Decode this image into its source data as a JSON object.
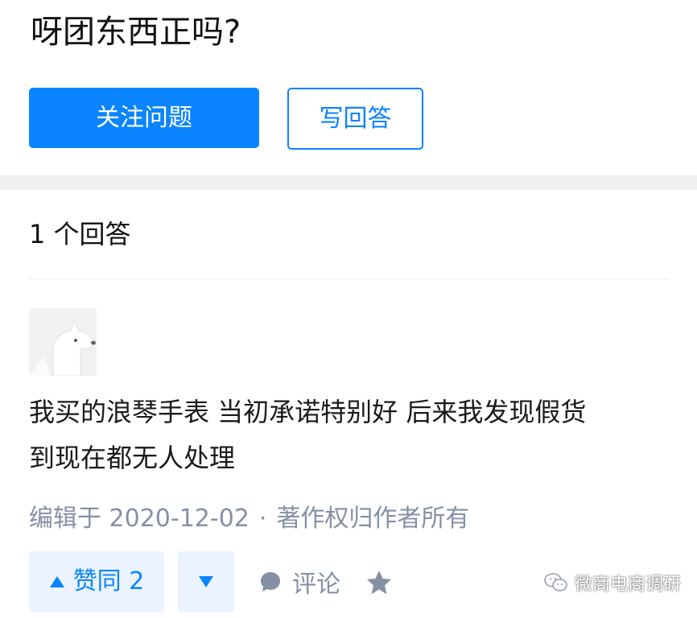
{
  "question": {
    "title": "呀团东西正吗?",
    "follow_label": "关注问题",
    "write_label": "写回答"
  },
  "answers": {
    "count_label": "1 个回答",
    "items": [
      {
        "avatar": "dog-avatar-icon",
        "text_lines": [
          "我买的浪琴手表 当初承诺特别好 后来我发现假货",
          "到现在都无人处理"
        ],
        "meta": {
          "edited": "编辑于 2020-12-02",
          "separator": "·",
          "copyright": "著作权归作者所有"
        },
        "actions": {
          "upvote_label": "赞同 2",
          "downvote_icon": "triangle-down-icon",
          "comment_label": "评论",
          "star_icon": "star-icon"
        }
      }
    ]
  },
  "watermark": {
    "text": "微商电商调研",
    "icon": "wechat-icon"
  },
  "colors": {
    "accent": "#0a84ff",
    "accent_light": "#eaf3ff",
    "meta_gray": "#8590a6",
    "text": "#121212"
  }
}
